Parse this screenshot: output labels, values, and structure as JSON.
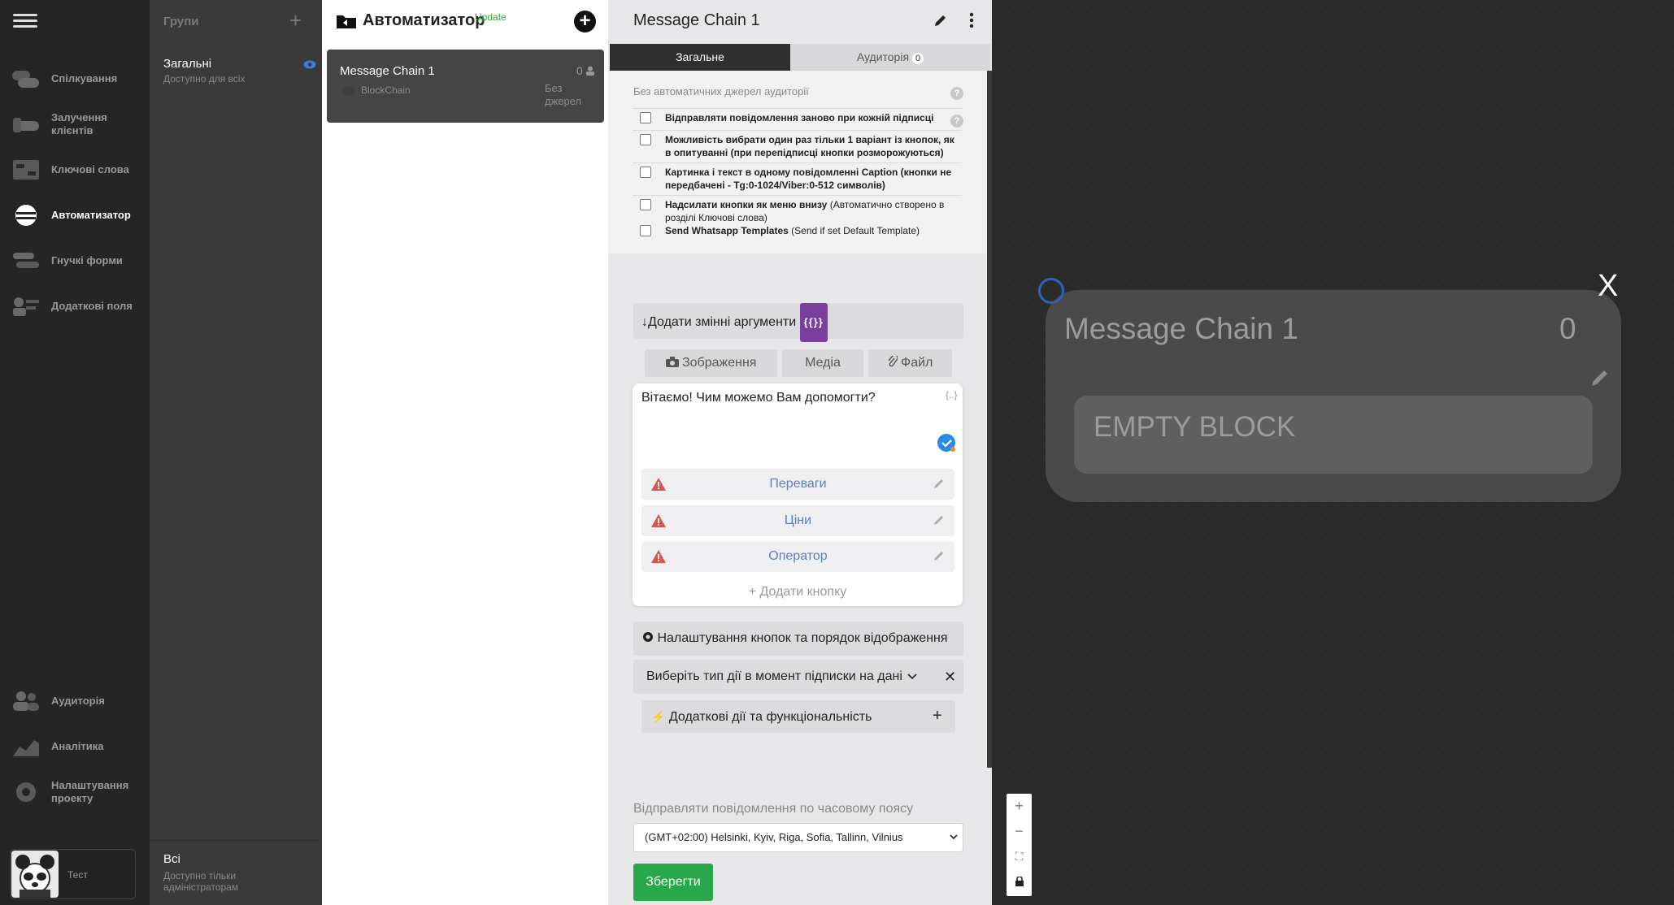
{
  "nav": {
    "items": [
      {
        "label": "Спілкування"
      },
      {
        "label": "Залучення клієнтів"
      },
      {
        "label": "Ключові слова"
      },
      {
        "label": "Автоматизатор"
      },
      {
        "label": "Гнучкі форми"
      },
      {
        "label": "Додаткові поля"
      },
      {
        "label": "Аудиторія"
      },
      {
        "label": "Аналітика"
      },
      {
        "label": "Налаштування проекту"
      }
    ],
    "user_name": "Тест"
  },
  "groups": {
    "title": "Групи",
    "items": [
      {
        "name": "Загальні",
        "sub": "Доступно для всіх"
      },
      {
        "name": "Всі",
        "sub": "Доступно тільки адміністраторам"
      }
    ]
  },
  "chains": {
    "title": "Автоматизатор",
    "update_badge": "Update",
    "card": {
      "name": "Message Chain 1",
      "sub": "BlockChain",
      "count": "0",
      "source": "Без джерел"
    }
  },
  "editor": {
    "title": "Message Chain 1",
    "tab_general": "Загальне",
    "tab_audience": "Аудиторія",
    "audience_count": "0",
    "options_header": "Без автоматичних джерел аудиторії",
    "options": [
      {
        "bold": "Відправляти повідомлення заново при кожній підписці",
        "normal": ""
      },
      {
        "bold": "Можливість вибрати один раз тільки 1 варіант із кнопок, як в опитуванні (при перепідписці кнопки розморожуються)",
        "normal": ""
      },
      {
        "bold": "Картинка і текст в одному повідомленні Caption (кнопки не передбачені - Tg:0-1024/Viber:0-512 символів)",
        "normal": ""
      },
      {
        "bold": "Надсилати кнопки як меню внизу",
        "normal": " (Автоматично створено в розділі Ключові слова)"
      },
      {
        "bold": "Send Whatsapp Templates",
        "normal": " (Send if set Default Template)"
      }
    ],
    "add_vars_label": "↓Додати змінні аргументи",
    "var_tag": "{{}}",
    "media_buttons": [
      "Зображення",
      "Медіа",
      "Файл"
    ],
    "message_text": "Вітаємо! Чим можемо Вам допомогти?",
    "message_var_hint": "{..}",
    "keyboard_buttons": [
      "Переваги",
      "Ціни",
      "Оператор"
    ],
    "add_button_label": "+ Додати кнопку",
    "settings_label": "Налаштування кнопок та порядок відображення",
    "action_select_label": "Виберіть тип дії в момент підписки на дані",
    "extra_actions_label": "Додаткові дії та функціональність",
    "timezone_label": "Відправляти повідомлення по часовому поясу",
    "timezone_value": "(GMT+02:00) Helsinki, Kyiv, Riga, Sofia, Tallinn, Vilnius",
    "save_label": "Зберегти"
  },
  "canvas": {
    "node_title": "Message Chain 1",
    "node_count": "0",
    "empty_block_label": "EMPTY BLOCK",
    "close_label": "X",
    "link_color": "#2f63b7"
  }
}
